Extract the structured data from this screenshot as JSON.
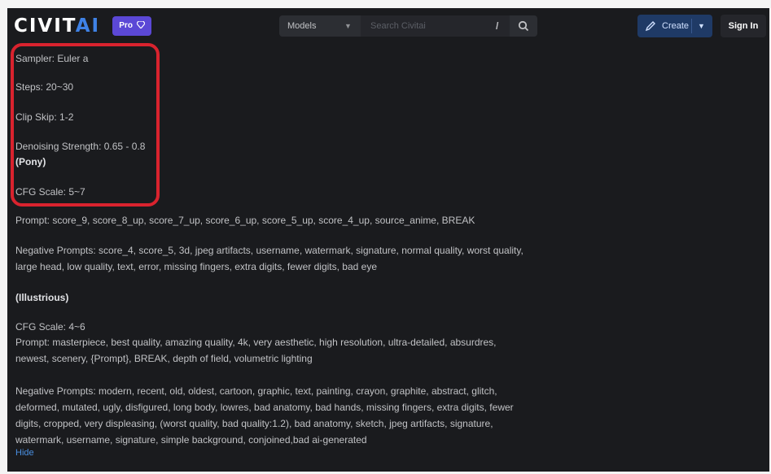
{
  "header": {
    "logo_civit": "CIVIT",
    "logo_ai": "AI",
    "pro_badge": "Pro",
    "search_select": "Models",
    "search_placeholder": "Search Civitai",
    "search_shortcut": "/",
    "create_label": "Create",
    "signin_label": "Sign In"
  },
  "settings": {
    "sampler": "Sampler: Euler a",
    "steps": "Steps: 20~30",
    "clip_skip": "Clip Skip: 1-2",
    "denoising": "Denoising Strength: 0.65 - 0.8",
    "pony_heading": "(Pony)",
    "cfg_pony": "CFG Scale: 5~7"
  },
  "pony": {
    "prompt": "Prompt: score_9, score_8_up, score_7_up, score_6_up, score_5_up, score_4_up, source_anime, BREAK",
    "negative": "Negative Prompts: score_4, score_5, 3d, jpeg artifacts, username, watermark, signature, normal quality, worst quality, large head, low quality, text, error, missing fingers, extra digits, fewer digits, bad eye"
  },
  "illustrious": {
    "heading": "(Illustrious)",
    "cfg": "CFG Scale: 4~6",
    "prompt": "Prompt: masterpiece, best quality, amazing quality, 4k, very aesthetic, high resolution, ultra-detailed, absurdres, newest, scenery, {Prompt}, BREAK, depth of field, volumetric lighting",
    "negative": "Negative Prompts: modern, recent, old, oldest, cartoon, graphic, text, painting, crayon, graphite, abstract, glitch, deformed, mutated, ugly, disfigured, long body, lowres, bad anatomy, bad hands, missing fingers, extra digits, fewer digits, cropped, very displeasing, (worst quality, bad quality:1.2), bad anatomy, sketch, jpeg artifacts, signature, watermark, username, signature, simple background, conjoined,bad ai-generated"
  },
  "hide_link": "Hide",
  "colors": {
    "background": "#1a1b1e",
    "text": "#c1c2c5",
    "accent_blue": "#3f82e6",
    "pro_purple": "#5b48d6",
    "highlight_red": "#d9232e"
  }
}
